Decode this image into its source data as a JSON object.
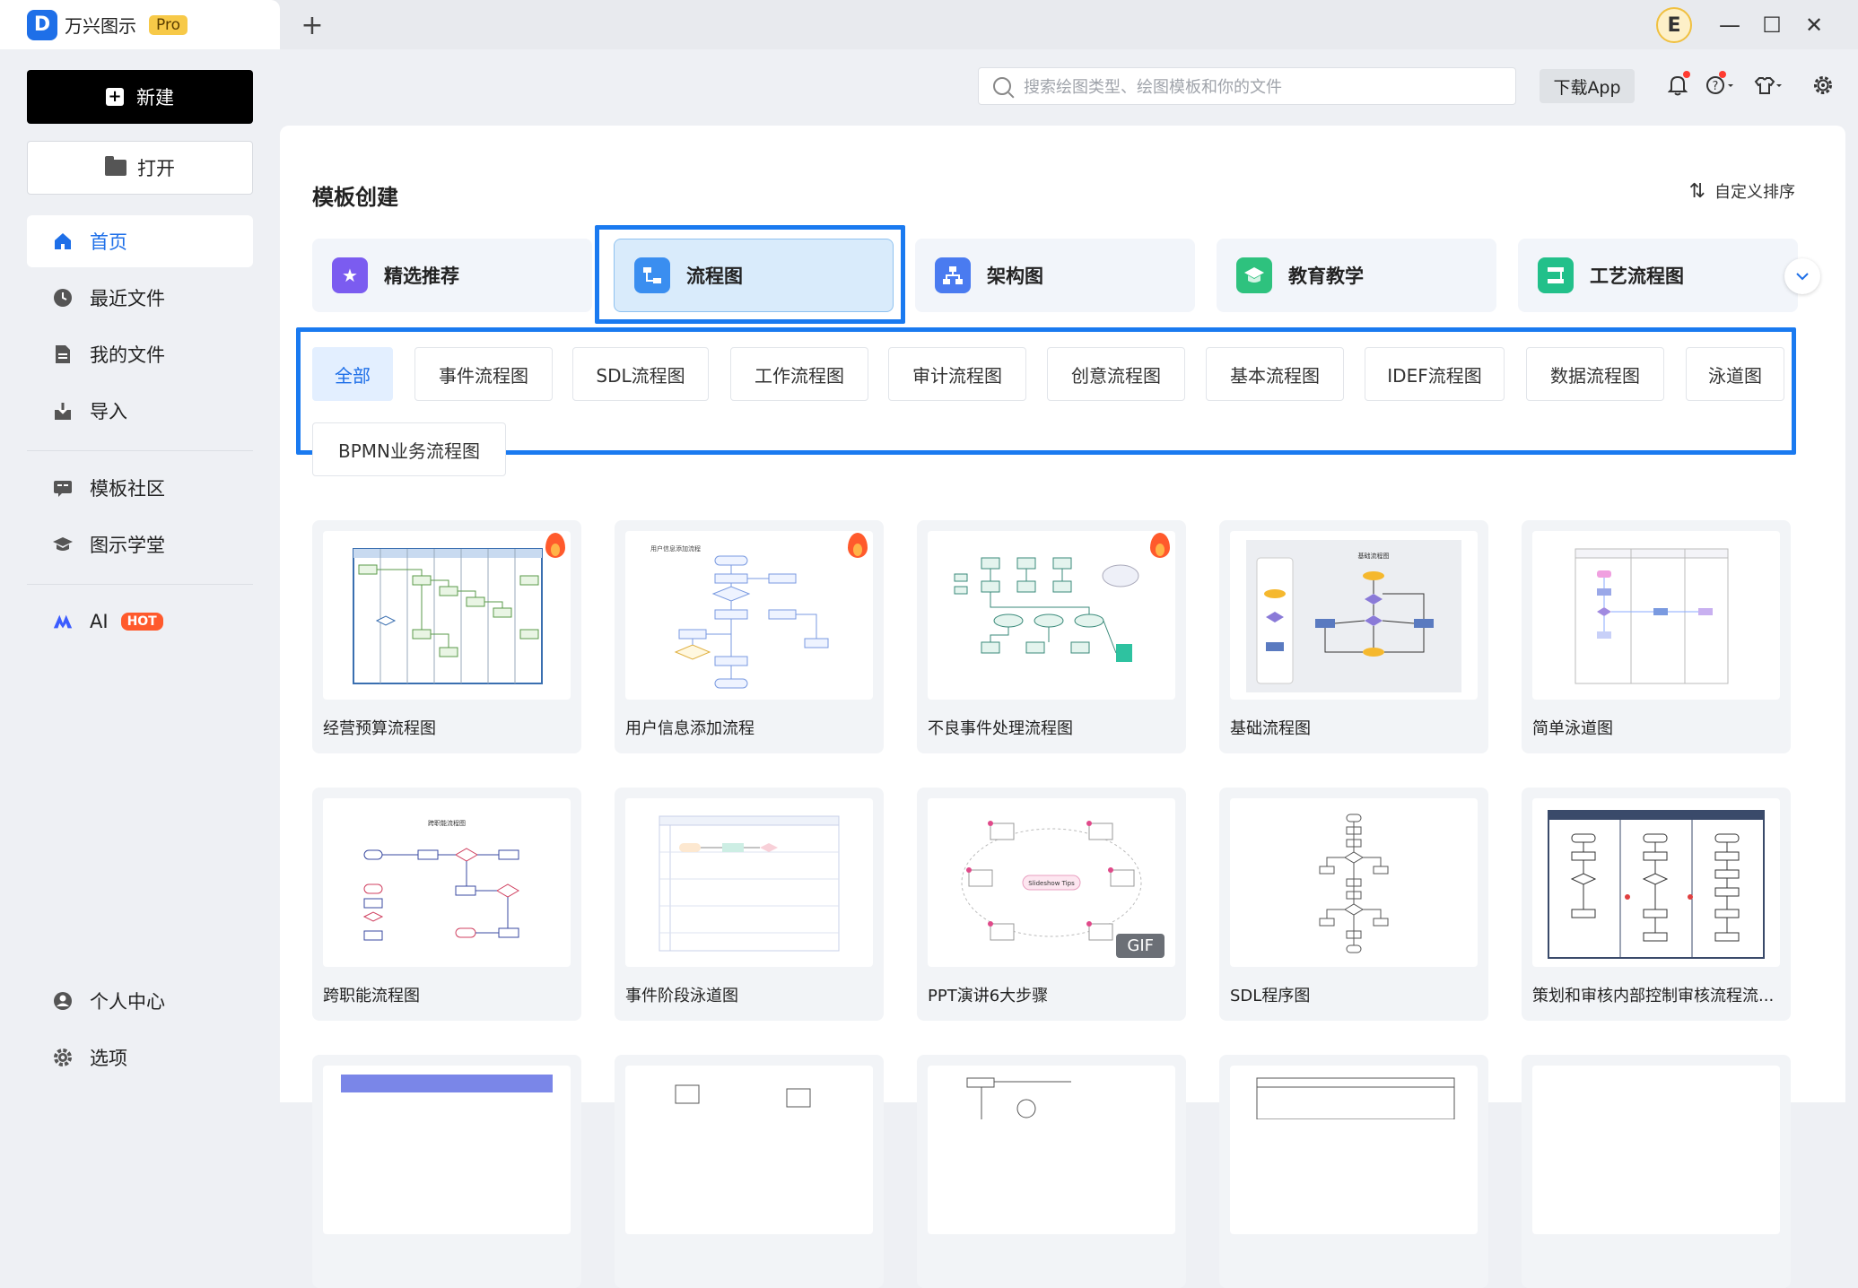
{
  "app": {
    "name": "万兴图示",
    "badge": "Pro"
  },
  "window": {
    "avatar_letter": "E",
    "minimize": "—",
    "maximize": "☐",
    "close": "✕",
    "new_tab": "+"
  },
  "sidebar": {
    "new_label": "新建",
    "open_label": "打开",
    "items": [
      {
        "label": "首页",
        "icon": "home-icon"
      },
      {
        "label": "最近文件",
        "icon": "clock-icon"
      },
      {
        "label": "我的文件",
        "icon": "file-icon"
      },
      {
        "label": "导入",
        "icon": "import-icon"
      },
      {
        "label": "模板社区",
        "icon": "community-icon"
      },
      {
        "label": "图示学堂",
        "icon": "graduation-icon"
      },
      {
        "label": "AI",
        "icon": "ai-icon",
        "badge": "HOT"
      },
      {
        "label": "个人中心",
        "icon": "user-icon"
      },
      {
        "label": "选项",
        "icon": "gear-icon"
      }
    ]
  },
  "topbar": {
    "search_placeholder": "搜索绘图类型、绘图模板和你的文件",
    "download_label": "下载App"
  },
  "main": {
    "section_title": "模板创建",
    "sort_label": "自定义排序",
    "categories": [
      {
        "label": "精选推荐",
        "color": "#7b5cf0"
      },
      {
        "label": "流程图",
        "color": "#3a8ef0"
      },
      {
        "label": "架构图",
        "color": "#4a7bf0"
      },
      {
        "label": "教育教学",
        "color": "#2ec27e"
      },
      {
        "label": "工艺流程图",
        "color": "#22c08a"
      }
    ],
    "chips": [
      "全部",
      "事件流程图",
      "SDL流程图",
      "工作流程图",
      "审计流程图",
      "创意流程图",
      "基本流程图",
      "IDEF流程图",
      "数据流程图",
      "泳道图",
      "BPMN业务流程图"
    ],
    "templates": [
      {
        "label": "经营预算流程图",
        "hot": true
      },
      {
        "label": "用户信息添加流程",
        "hot": true
      },
      {
        "label": "不良事件处理流程图",
        "hot": true
      },
      {
        "label": "基础流程图",
        "hot": false
      },
      {
        "label": "简单泳道图",
        "hot": false
      },
      {
        "label": "跨职能流程图",
        "hot": false
      },
      {
        "label": "事件阶段泳道图",
        "hot": false
      },
      {
        "label": "PPT演讲6大步骤",
        "hot": false,
        "badge": "GIF"
      },
      {
        "label": "SDL程序图",
        "hot": false
      },
      {
        "label": "策划和审核内部控制审核流程流...",
        "hot": false
      }
    ],
    "thumb_texts": {
      "t2_title": "用户信息添加流程",
      "t4_title": "基础流程图",
      "t6_title": "跨职能流程图",
      "t8_center": "Slideshow Tips"
    }
  }
}
